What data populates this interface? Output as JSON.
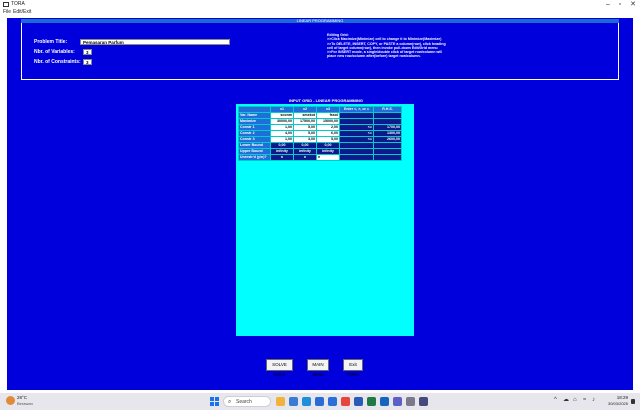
{
  "window": {
    "title": "TORA",
    "controls": {
      "minimize": "–",
      "maximize": "▫",
      "close": "✕"
    }
  },
  "menu": {
    "items": [
      "File",
      "Edit/Exit"
    ]
  },
  "header": {
    "title": "LINEAR PROGRAMMING"
  },
  "problem": {
    "title_label": "Problem Title:",
    "title_value": "Pemasaran Parfum",
    "vars_label": "Nbr. of Variables:",
    "vars_value": "3",
    "cons_label": "Nbr. of Constraints:",
    "cons_value": "3"
  },
  "editing_help": [
    "Editing Grid:",
    ">>Click Maximize(Minimize) cell to change it to Minimize(Maximize)",
    ">>To DELETE, INSERT, COPY, or PASTE a column(row), click heading",
    "cell of target column(row), then invoke pull-down Edit/Grid menu",
    ">>For INSERT mode, a single/double click of target row/column will",
    "place new row/column after(before) target row/column."
  ],
  "grid": {
    "title": "INPUT GRID - LINEAR PROGRAMMING",
    "headers": [
      "",
      "x1",
      "x2",
      "x3",
      "Enter <, >, or =",
      "R.H.S."
    ],
    "rows": [
      {
        "label": "Var. Name",
        "cells": [
          "sconm",
          "smekot",
          "fssol",
          "",
          ""
        ],
        "style": "names"
      },
      {
        "label": "Maximize",
        "cells": [
          "30000,00",
          "17500,00",
          "15000,00",
          "",
          ""
        ],
        "style": "values"
      },
      {
        "label": "Constr 1",
        "cells": [
          "1,00",
          "5,00",
          "2,00",
          "<=",
          "1700,00"
        ],
        "style": "values"
      },
      {
        "label": "Constr 2",
        "cells": [
          "4,00",
          "5,00",
          "6,00",
          "<=",
          "1300,00"
        ],
        "style": "values"
      },
      {
        "label": "Constr 3",
        "cells": [
          "1,00",
          "3,00",
          "5,00",
          "<=",
          "2600,00"
        ],
        "style": "values"
      },
      {
        "label": "Lower Bound",
        "cells": [
          "0,00",
          "0,00",
          "0,00",
          "",
          ""
        ],
        "style": "navy"
      },
      {
        "label": "Upper Bound",
        "cells": [
          "infinity",
          "infinity",
          "infinity",
          "",
          ""
        ],
        "style": "navy"
      },
      {
        "label": "Unrestr'd (y/n)?",
        "cells": [
          "n",
          "n",
          "n",
          "",
          ""
        ],
        "style": "navy"
      }
    ]
  },
  "buttons": {
    "solve": "SOLVE Menu",
    "main_menu": "MAIN Menu",
    "exit": "Exit TORA"
  },
  "taskbar": {
    "weather_temp": "28°C",
    "weather_cond": "Berawan",
    "search_label": "Search",
    "clock_time": "18:29",
    "clock_date": "30/03/2025",
    "pinned_icons": [
      "file-explorer-icon",
      "widgets-icon",
      "edge-icon",
      "store-icon",
      "mail-icon",
      "chrome-icon",
      "word-icon",
      "excel-icon",
      "outlook-icon",
      "teams-icon",
      "settings-icon",
      "app-icon"
    ],
    "pinned_colors": [
      "#f2b33d",
      "#3a7bd5",
      "#1f8fd9",
      "#2b6cd4",
      "#2a6fd8",
      "#e8453c",
      "#2b5bb8",
      "#1f7a45",
      "#1565c0",
      "#5b5fc7",
      "#7a7a8a",
      "#444c7c"
    ]
  },
  "colors": {
    "main_bg": "#0000dd",
    "header_cell": "#1e6fd9",
    "grid_bg": "#00ffff",
    "navy_cell": "#0c1a8c"
  }
}
